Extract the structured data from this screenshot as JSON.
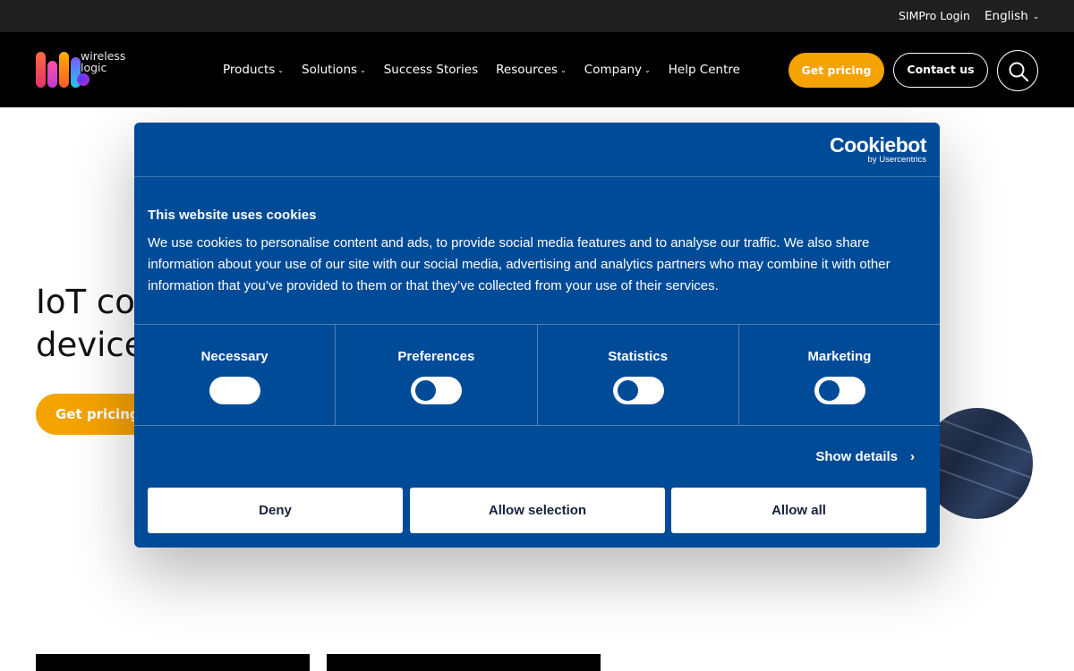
{
  "topbar": {
    "simpro_login": "SIMPro Login",
    "language": "English"
  },
  "nav": {
    "logo_text_line1": "wireless",
    "logo_text_line2": "logic",
    "items": [
      {
        "label": "Products",
        "dropdown": true
      },
      {
        "label": "Solutions",
        "dropdown": true
      },
      {
        "label": "Success Stories",
        "dropdown": false
      },
      {
        "label": "Resources",
        "dropdown": true
      },
      {
        "label": "Company",
        "dropdown": true
      },
      {
        "label": "Help Centre",
        "dropdown": false
      }
    ],
    "get_pricing": "Get pricing",
    "contact_us": "Contact us",
    "accent_color": "#f5a300"
  },
  "hero": {
    "title_line1": "IoT cor",
    "title_line2": "device",
    "cta": "Get pricing"
  },
  "cookie": {
    "brand_name": "Cookiebot",
    "brand_by": "by Usercentrics",
    "title": "This website uses cookies",
    "description": "We use cookies to personalise content and ads, to provide social media features and to analyse our traffic. We also share information about your use of our site with our social media, advertising and analytics partners who may combine it with other information that you’ve provided to them or that they’ve collected from your use of their services.",
    "categories": [
      {
        "label": "Necessary",
        "enabled": true
      },
      {
        "label": "Preferences",
        "enabled": false
      },
      {
        "label": "Statistics",
        "enabled": false
      },
      {
        "label": "Marketing",
        "enabled": false
      }
    ],
    "show_details": "Show details",
    "deny": "Deny",
    "allow_selection": "Allow selection",
    "allow_all": "Allow all",
    "background_color": "#004b98"
  }
}
